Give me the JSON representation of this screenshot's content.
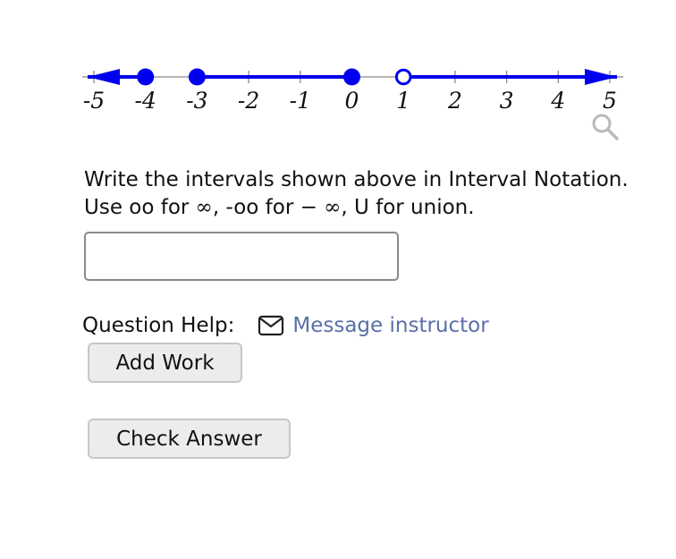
{
  "number_line": {
    "ticks": [
      "-5",
      "-4",
      "-3",
      "-2",
      "-1",
      "0",
      "1",
      "2",
      "3",
      "4",
      "5"
    ],
    "line_color": "#0000ee",
    "axis_color": "#888888",
    "segments": [
      {
        "from": "-inf",
        "to": -4
      },
      {
        "from": -3,
        "to": 0
      },
      {
        "from": 1,
        "to": "inf"
      }
    ],
    "points": [
      {
        "x": -4,
        "filled": true
      },
      {
        "x": -3,
        "filled": true
      },
      {
        "x": 0,
        "filled": true
      },
      {
        "x": 1,
        "filled": false
      }
    ]
  },
  "zoom_icon": "magnifier-icon",
  "instructions": {
    "line1": "Write the intervals shown above in Interval Notation.",
    "line2_a": "Use oo for ",
    "line2_inf": "∞",
    "line2_b": ", -oo for ",
    "line2_neginf": "− ∞",
    "line2_c": ", U for union."
  },
  "answer": {
    "value": "",
    "placeholder": ""
  },
  "help": {
    "label": "Question Help:",
    "message_icon": "envelope-icon",
    "message_link": "Message instructor"
  },
  "buttons": {
    "add_work": "Add Work",
    "check_answer": "Check Answer"
  }
}
